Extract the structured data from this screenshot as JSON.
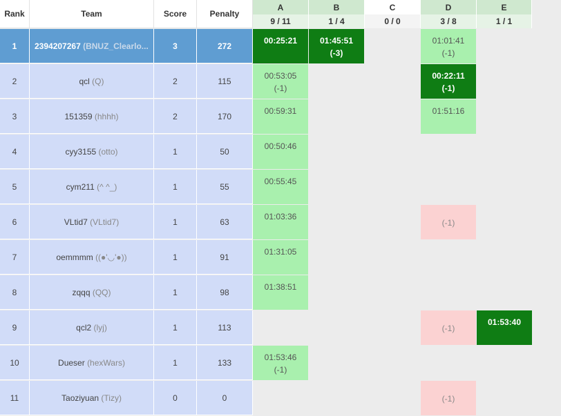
{
  "columns": {
    "rank": "Rank",
    "team": "Team",
    "score": "Score",
    "penalty": "Penalty"
  },
  "problems": [
    {
      "label": "A",
      "stat": "9 / 11"
    },
    {
      "label": "B",
      "stat": "1 / 4"
    },
    {
      "label": "C",
      "stat": "0 / 0"
    },
    {
      "label": "D",
      "stat": "3 / 8"
    },
    {
      "label": "E",
      "stat": "1 / 1"
    }
  ],
  "rows": [
    {
      "rank": "1",
      "name": "2394207267",
      "nick": "(BNUZ_Clearlo...",
      "score": "3",
      "penalty": "272",
      "cells": [
        {
          "s": "fb",
          "t": "00:25:21",
          "a": ""
        },
        {
          "s": "fb",
          "t": "01:45:51",
          "a": "(-3)"
        },
        null,
        {
          "s": "ac",
          "t": "01:01:41",
          "a": "(-1)"
        },
        null
      ]
    },
    {
      "rank": "2",
      "name": "qcl",
      "nick": "(Q)",
      "score": "2",
      "penalty": "115",
      "cells": [
        {
          "s": "ac",
          "t": "00:53:05",
          "a": "(-1)"
        },
        null,
        null,
        {
          "s": "fb",
          "t": "00:22:11",
          "a": "(-1)"
        },
        null
      ]
    },
    {
      "rank": "3",
      "name": "151359",
      "nick": "(hhhh)",
      "score": "2",
      "penalty": "170",
      "cells": [
        {
          "s": "ac",
          "t": "00:59:31",
          "a": ""
        },
        null,
        null,
        {
          "s": "ac",
          "t": "01:51:16",
          "a": ""
        },
        null
      ]
    },
    {
      "rank": "4",
      "name": "cyy3155",
      "nick": "(otto)",
      "score": "1",
      "penalty": "50",
      "cells": [
        {
          "s": "ac",
          "t": "00:50:46",
          "a": ""
        },
        null,
        null,
        null,
        null
      ]
    },
    {
      "rank": "5",
      "name": "cym211",
      "nick": "(^ ^_)",
      "score": "1",
      "penalty": "55",
      "cells": [
        {
          "s": "ac",
          "t": "00:55:45",
          "a": ""
        },
        null,
        null,
        null,
        null
      ]
    },
    {
      "rank": "6",
      "name": "VLtid7",
      "nick": "(VLtid7)",
      "score": "1",
      "penalty": "63",
      "cells": [
        {
          "s": "ac",
          "t": "01:03:36",
          "a": ""
        },
        null,
        null,
        {
          "s": "wa",
          "t": "",
          "a": "(-1)"
        },
        null
      ]
    },
    {
      "rank": "7",
      "name": "oemmmm",
      "nick": "((●'◡'●))",
      "score": "1",
      "penalty": "91",
      "cells": [
        {
          "s": "ac",
          "t": "01:31:05",
          "a": ""
        },
        null,
        null,
        null,
        null
      ]
    },
    {
      "rank": "8",
      "name": "zqqq",
      "nick": "(QQ)",
      "score": "1",
      "penalty": "98",
      "cells": [
        {
          "s": "ac",
          "t": "01:38:51",
          "a": ""
        },
        null,
        null,
        null,
        null
      ]
    },
    {
      "rank": "9",
      "name": "qcl2",
      "nick": "(lyj)",
      "score": "1",
      "penalty": "113",
      "cells": [
        null,
        null,
        null,
        {
          "s": "wa",
          "t": "",
          "a": "(-1)"
        },
        {
          "s": "fb",
          "t": "01:53:40",
          "a": ""
        }
      ]
    },
    {
      "rank": "10",
      "name": "Dueser",
      "nick": "(hexWars)",
      "score": "1",
      "penalty": "133",
      "cells": [
        {
          "s": "ac",
          "t": "01:53:46",
          "a": "(-1)"
        },
        null,
        null,
        null,
        null
      ]
    },
    {
      "rank": "11",
      "name": "Taoziyuan",
      "nick": "(Tizy)",
      "score": "0",
      "penalty": "0",
      "cells": [
        null,
        null,
        null,
        {
          "s": "wa",
          "t": "",
          "a": "(-1)"
        },
        null
      ]
    }
  ]
}
